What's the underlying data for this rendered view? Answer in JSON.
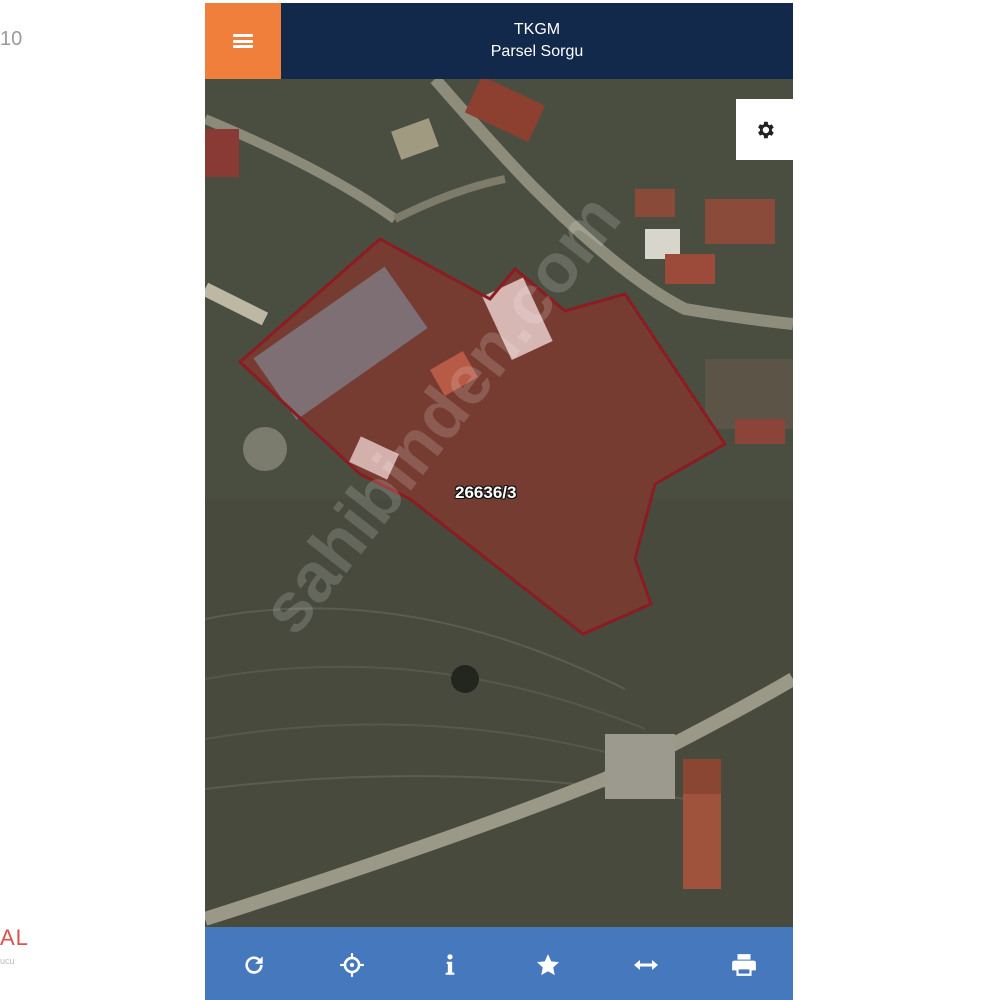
{
  "page_edge": {
    "left_text": "10",
    "logo_text": "AL",
    "logo_sub": "ucu"
  },
  "header": {
    "title": "TKGM",
    "subtitle": "Parsel Sorgu",
    "menu_icon": "hamburger-icon"
  },
  "map": {
    "parcel_label": "26636/3",
    "watermark": "sahibinden.com",
    "parcel_outline_color": "#8a1c22",
    "settings_icon": "gear-icon"
  },
  "toolbar": {
    "background": "#4578bd",
    "buttons": [
      {
        "icon": "refresh-icon"
      },
      {
        "icon": "locate-icon"
      },
      {
        "icon": "info-icon"
      },
      {
        "icon": "star-icon"
      },
      {
        "icon": "measure-icon"
      },
      {
        "icon": "print-icon"
      }
    ]
  },
  "colors": {
    "header_bg": "#13294b",
    "menu_bg": "#f07f3c",
    "toolbar_bg": "#4578bd"
  }
}
